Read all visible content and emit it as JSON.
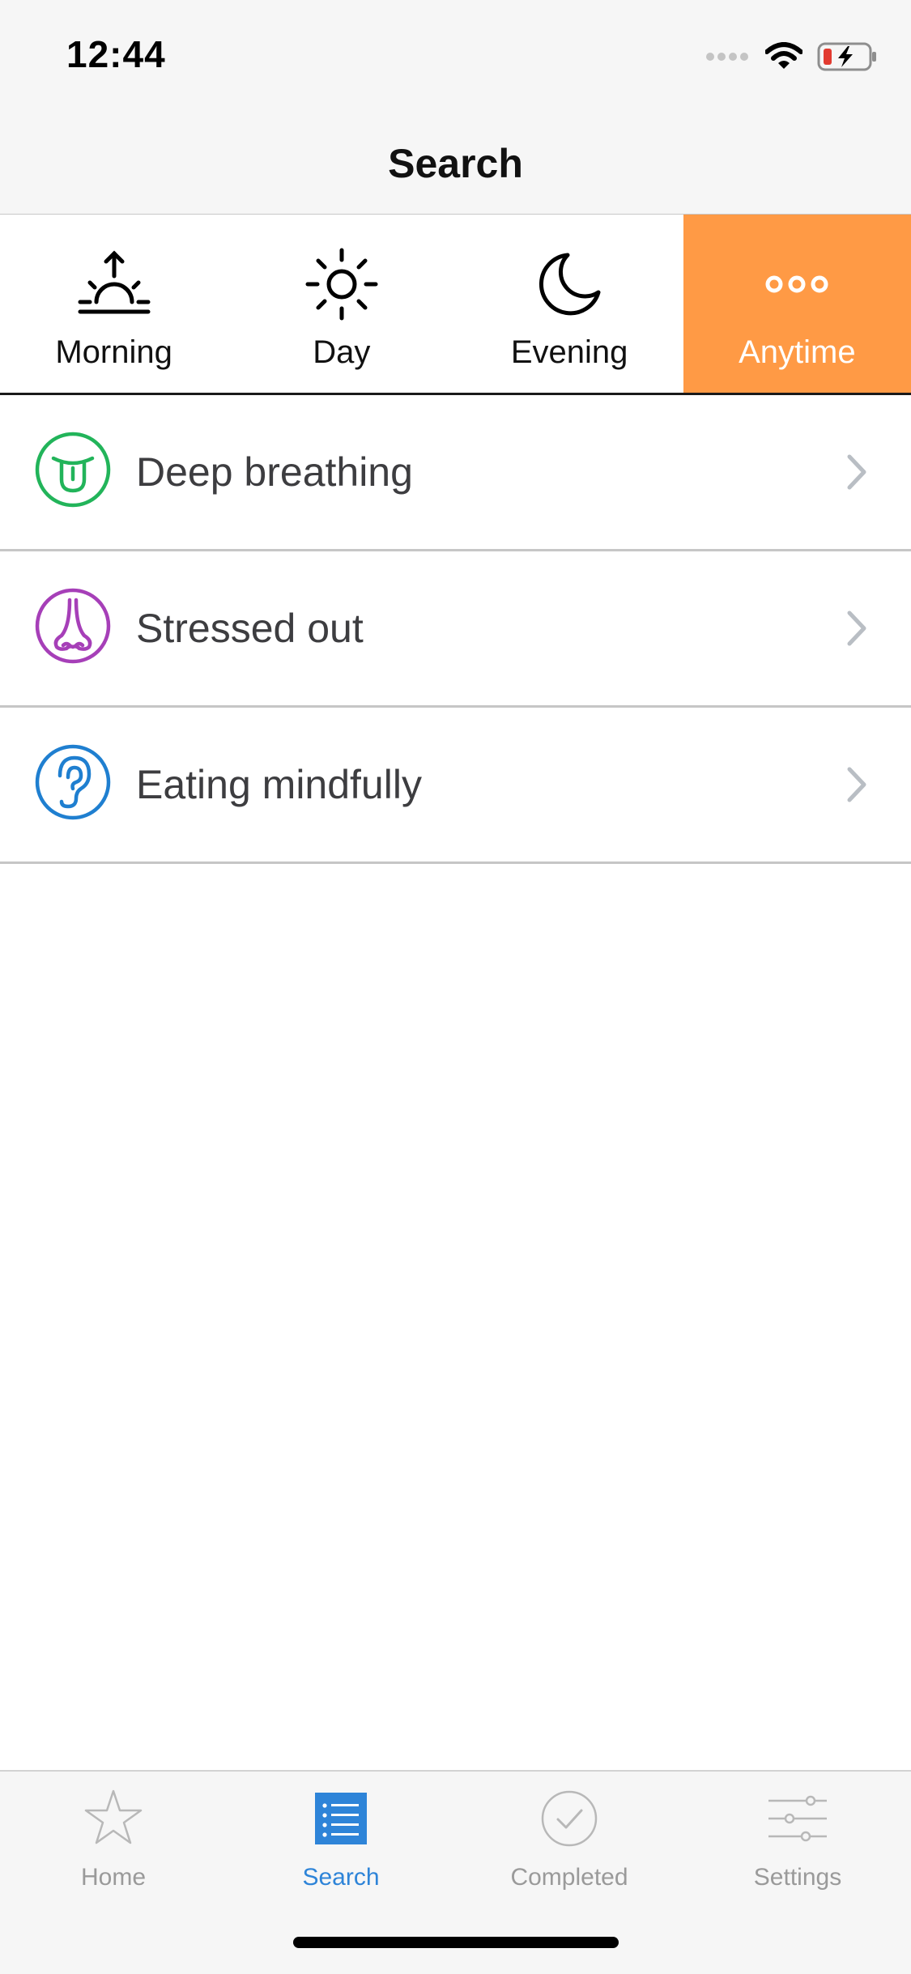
{
  "status_bar": {
    "time": "12:44",
    "icons": [
      "cellular-dots-icon",
      "wifi-icon",
      "battery-charging-icon"
    ]
  },
  "nav": {
    "title": "Search"
  },
  "segments": [
    {
      "label": "Morning",
      "icon": "sunrise-icon",
      "active": false
    },
    {
      "label": "Day",
      "icon": "sun-icon",
      "active": false
    },
    {
      "label": "Evening",
      "icon": "moon-icon",
      "active": false
    },
    {
      "label": "Anytime",
      "icon": "ellipsis-icon",
      "active": true
    }
  ],
  "list": [
    {
      "label": "Deep breathing",
      "icon": "tongue-face-icon",
      "color": "#22b45a"
    },
    {
      "label": "Stressed out",
      "icon": "nose-icon",
      "color": "#a63fb8"
    },
    {
      "label": "Eating mindfully",
      "icon": "ear-icon",
      "color": "#1f7fd0"
    }
  ],
  "tabs": [
    {
      "label": "Home",
      "icon": "star-icon",
      "active": false
    },
    {
      "label": "Search",
      "icon": "list-icon",
      "active": true
    },
    {
      "label": "Completed",
      "icon": "checkmark-circle-icon",
      "active": false
    },
    {
      "label": "Settings",
      "icon": "sliders-icon",
      "active": false
    }
  ],
  "colors": {
    "accent": "#ff9a45",
    "tab_active": "#2e84d8",
    "tab_inactive": "#9a9a9a"
  }
}
